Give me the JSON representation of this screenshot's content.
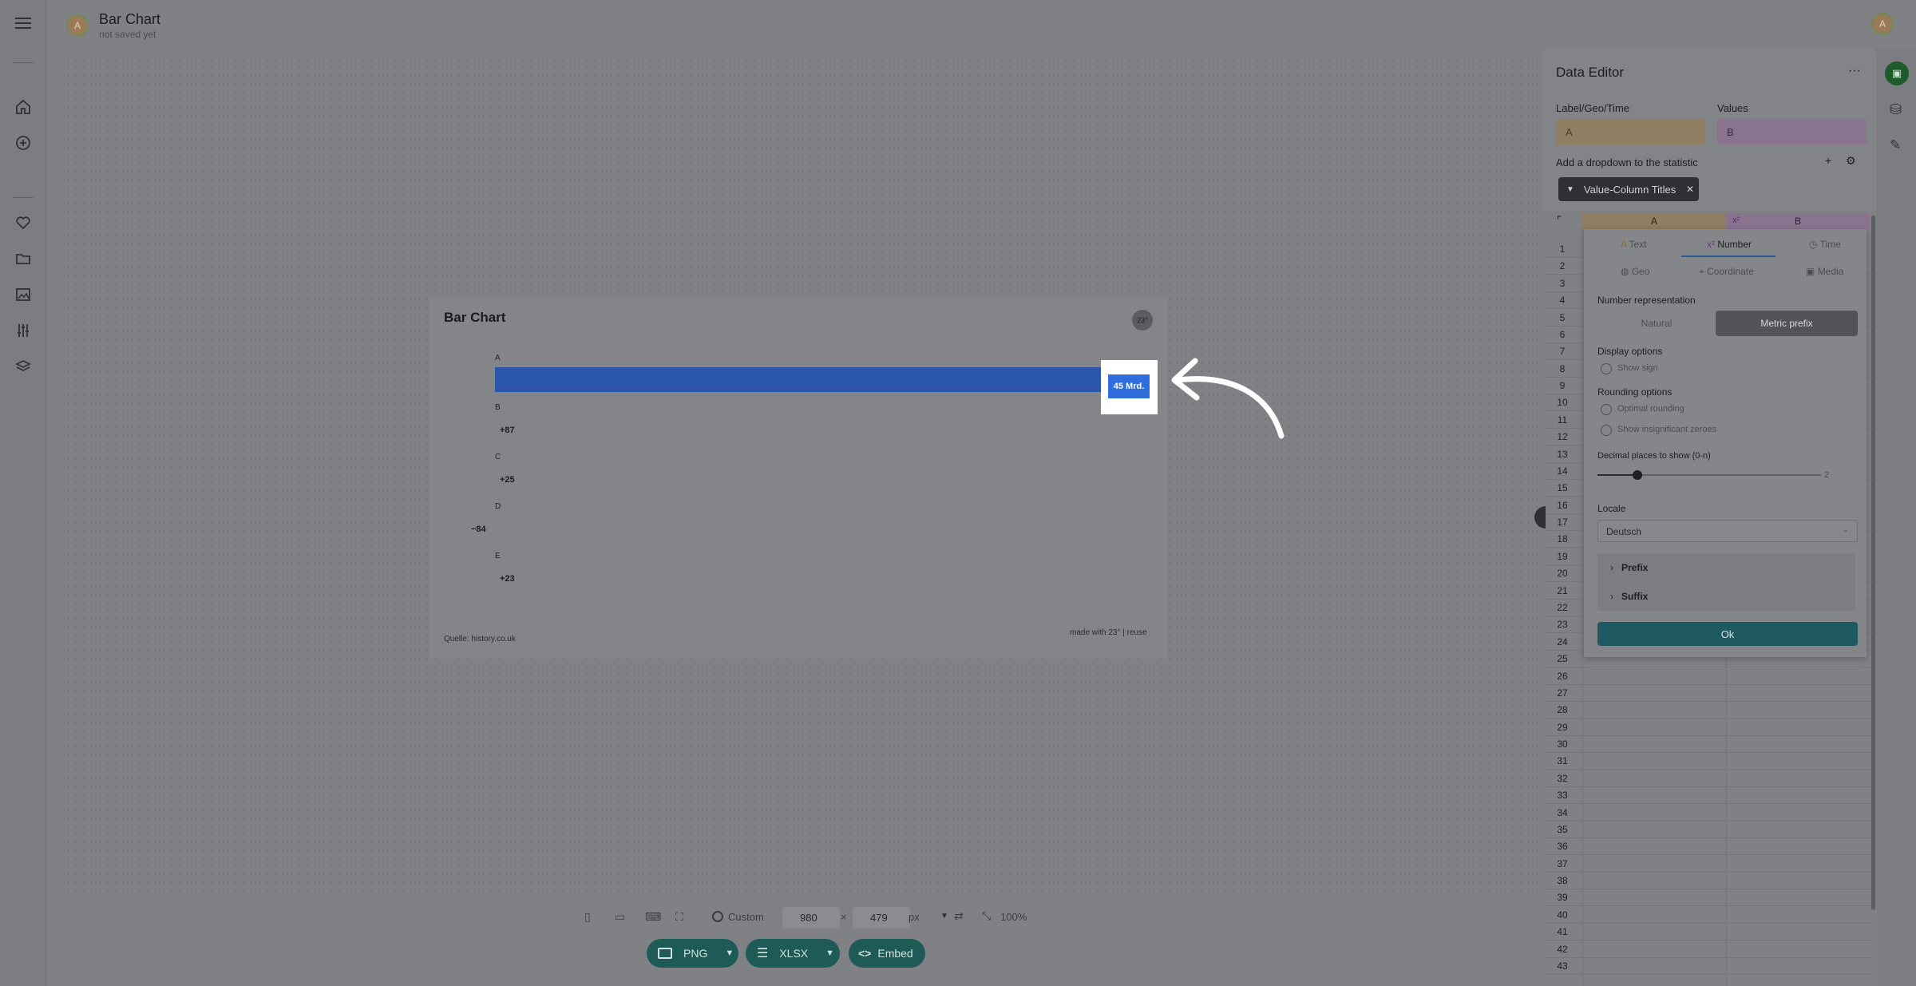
{
  "app": {
    "doc_title": "Bar Chart",
    "doc_status": "not saved yet",
    "user_initial": "A"
  },
  "sidebar": {
    "items": [
      "home-icon",
      "add-icon",
      "heart-icon",
      "folder-icon",
      "image-icon",
      "sliders-icon",
      "layers-icon"
    ]
  },
  "chart_card": {
    "title": "Bar Chart",
    "source": "Quelle: history.co.uk",
    "made_with": "made with 23° | reuse",
    "logo_text": "23°"
  },
  "chart_data": {
    "type": "bar",
    "orientation": "horizontal",
    "categories": [
      "A",
      "B",
      "C",
      "D",
      "E"
    ],
    "values": [
      45000000000,
      87,
      25,
      -84,
      23
    ],
    "data_labels": [
      "45 Mrd.",
      "+87",
      "+25",
      "−84",
      "+23"
    ],
    "title": "Bar Chart",
    "bar_color": "#2a55a8"
  },
  "highlight": {
    "label": "45 Mrd.",
    "color": "#2f6fdd"
  },
  "bottom_toolbar": {
    "preset": "Custom",
    "width": "980",
    "height": "479",
    "times": "×",
    "unit": "px",
    "zoom": "100%",
    "export_png": "PNG",
    "export_xlsx": "XLSX",
    "embed": "Embed"
  },
  "editor": {
    "title": "Data Editor",
    "menu": "···",
    "label_col_title": "Label/Geo/Time",
    "label_col_value": "A",
    "values_col_title": "Values",
    "values_col_value": "B",
    "dropdown_text": "Add a dropdown to the statistic",
    "plus": "+",
    "chip_label": "Value-Column Titles",
    "col_a": "A",
    "col_b": "B",
    "col_b_type": "x²",
    "row_numbers": [
      "1",
      "2",
      "3",
      "4",
      "5",
      "6",
      "7",
      "8",
      "9",
      "10",
      "11",
      "12",
      "13",
      "14",
      "15",
      "16",
      "17",
      "18",
      "19",
      "20",
      "21",
      "22",
      "23",
      "24",
      "25",
      "26",
      "27",
      "28",
      "29",
      "30",
      "31",
      "32",
      "33",
      "34",
      "35",
      "36",
      "37",
      "38",
      "39",
      "40",
      "41",
      "42",
      "43"
    ]
  },
  "popup": {
    "tabs": [
      "Text",
      "Number",
      "Time",
      "Geo",
      "Coordinate",
      "Media"
    ],
    "active_tab": "Number",
    "number_repr_label": "Number representation",
    "repr_natural": "Natural",
    "repr_metric": "Metric prefix",
    "display_options_label": "Display options",
    "show_sign": "Show sign",
    "rounding_label": "Rounding options",
    "optimal_rounding": "Optimal rounding",
    "show_insignificant": "Show insignificant zeroes",
    "decimal_label": "Decimal places to show (0-n)",
    "decimal_value": "2",
    "decimal_fraction": 0.18,
    "locale_label": "Locale",
    "locale_value": "Deutsch",
    "prefix_label": "Prefix",
    "suffix_label": "Suffix",
    "ok_label": "Ok"
  }
}
